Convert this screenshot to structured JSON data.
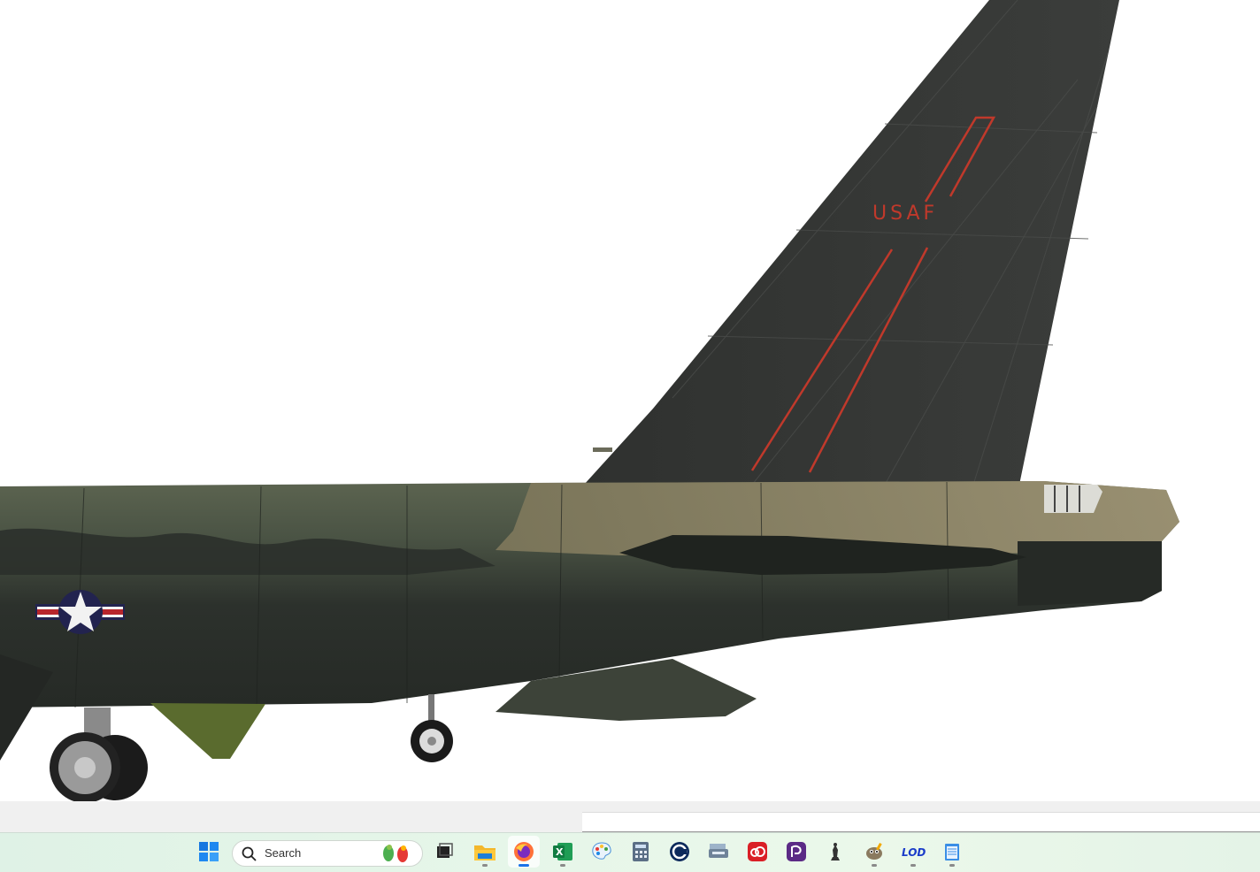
{
  "viewer": {
    "tail_marking": "USAF",
    "colors": {
      "tail": "#353735",
      "camo_dark": "#2f342f",
      "camo_green": "#5e6650",
      "camo_tan": "#8d8566",
      "red_stripe": "#c0392b",
      "roundel_blue": "#22234f",
      "roundel_red": "#b8262c"
    }
  },
  "taskbar": {
    "search_placeholder": "Search",
    "apps": [
      {
        "name": "windows-start-icon",
        "label": "Start"
      },
      {
        "name": "task-view-icon",
        "label": "Task View"
      },
      {
        "name": "file-explorer-icon",
        "label": "File Explorer"
      },
      {
        "name": "firefox-icon",
        "label": "Firefox",
        "active": true
      },
      {
        "name": "excel-icon",
        "label": "Excel"
      },
      {
        "name": "paint-icon",
        "label": "Paint"
      },
      {
        "name": "calculator-icon",
        "label": "Calculator"
      },
      {
        "name": "ccleaner-icon",
        "label": "CCleaner"
      },
      {
        "name": "scanner-icon",
        "label": "Scanner"
      },
      {
        "name": "creative-cloud-icon",
        "label": "Creative Cloud"
      },
      {
        "name": "pdf-app-icon",
        "label": "PDF App"
      },
      {
        "name": "chess-icon",
        "label": "Chess"
      },
      {
        "name": "gimp-icon",
        "label": "GIMP"
      },
      {
        "name": "lod-icon",
        "label": "LOD"
      },
      {
        "name": "notepad-icon",
        "label": "Notepad"
      }
    ]
  }
}
